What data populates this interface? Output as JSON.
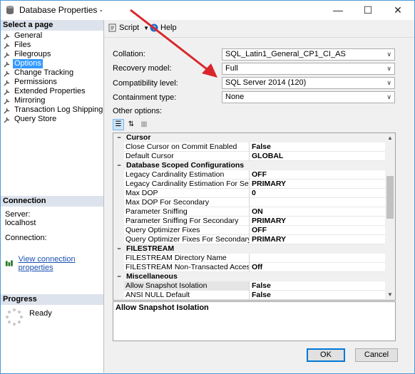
{
  "window": {
    "title": "Database Properties -"
  },
  "sidebar": {
    "select_page_header": "Select a page",
    "items": [
      {
        "label": "General",
        "icon": "wrench-icon"
      },
      {
        "label": "Files",
        "icon": "wrench-icon"
      },
      {
        "label": "Filegroups",
        "icon": "wrench-icon"
      },
      {
        "label": "Options",
        "icon": "wrench-icon",
        "selected": true
      },
      {
        "label": "Change Tracking",
        "icon": "wrench-icon"
      },
      {
        "label": "Permissions",
        "icon": "wrench-icon"
      },
      {
        "label": "Extended Properties",
        "icon": "wrench-icon"
      },
      {
        "label": "Mirroring",
        "icon": "wrench-icon"
      },
      {
        "label": "Transaction Log Shipping",
        "icon": "wrench-icon"
      },
      {
        "label": "Query Store",
        "icon": "wrench-icon"
      }
    ],
    "connection": {
      "header": "Connection",
      "server_label": "Server:",
      "server_value": "localhost",
      "connection_label": "Connection:",
      "view_link": "View connection properties"
    },
    "progress": {
      "header": "Progress",
      "status": "Ready"
    }
  },
  "toolbar": {
    "script_label": "Script",
    "help_label": "Help"
  },
  "form": {
    "collation": {
      "label": "Collation:",
      "value": "SQL_Latin1_General_CP1_CI_AS"
    },
    "recovery_model": {
      "label": "Recovery model:",
      "value": "Full"
    },
    "compatibility_level": {
      "label": "Compatibility level:",
      "value": "SQL Server 2014 (120)"
    },
    "containment_type": {
      "label": "Containment type:",
      "value": "None"
    },
    "other_options_label": "Other options:"
  },
  "property_grid": {
    "rows": [
      {
        "type": "category",
        "name": "Cursor"
      },
      {
        "type": "prop",
        "name": "Close Cursor on Commit Enabled",
        "value": "False"
      },
      {
        "type": "prop",
        "name": "Default Cursor",
        "value": "GLOBAL"
      },
      {
        "type": "category",
        "name": "Database Scoped Configurations"
      },
      {
        "type": "prop",
        "name": "Legacy Cardinality Estimation",
        "value": "OFF"
      },
      {
        "type": "prop",
        "name": "Legacy Cardinality Estimation For Secondary",
        "value": "PRIMARY"
      },
      {
        "type": "prop",
        "name": "Max DOP",
        "value": "0"
      },
      {
        "type": "prop",
        "name": "Max DOP For Secondary",
        "value": ""
      },
      {
        "type": "prop",
        "name": "Parameter Sniffing",
        "value": "ON"
      },
      {
        "type": "prop",
        "name": "Parameter Sniffing For Secondary",
        "value": "PRIMARY"
      },
      {
        "type": "prop",
        "name": "Query Optimizer Fixes",
        "value": "OFF"
      },
      {
        "type": "prop",
        "name": "Query Optimizer Fixes For Secondary",
        "value": "PRIMARY"
      },
      {
        "type": "category",
        "name": "FILESTREAM"
      },
      {
        "type": "prop",
        "name": "FILESTREAM Directory Name",
        "value": ""
      },
      {
        "type": "prop",
        "name": "FILESTREAM Non-Transacted Access",
        "value": "Off"
      },
      {
        "type": "category",
        "name": "Miscellaneous"
      },
      {
        "type": "prop",
        "name": "Allow Snapshot Isolation",
        "value": "False",
        "selected": true
      },
      {
        "type": "prop",
        "name": "ANSI NULL Default",
        "value": "False"
      }
    ],
    "description": "Allow Snapshot Isolation"
  },
  "buttons": {
    "ok": "OK",
    "cancel": "Cancel"
  },
  "colors": {
    "accent": "#0078d7",
    "selection": "#3399ff",
    "annotation_arrow": "#d9262b"
  }
}
